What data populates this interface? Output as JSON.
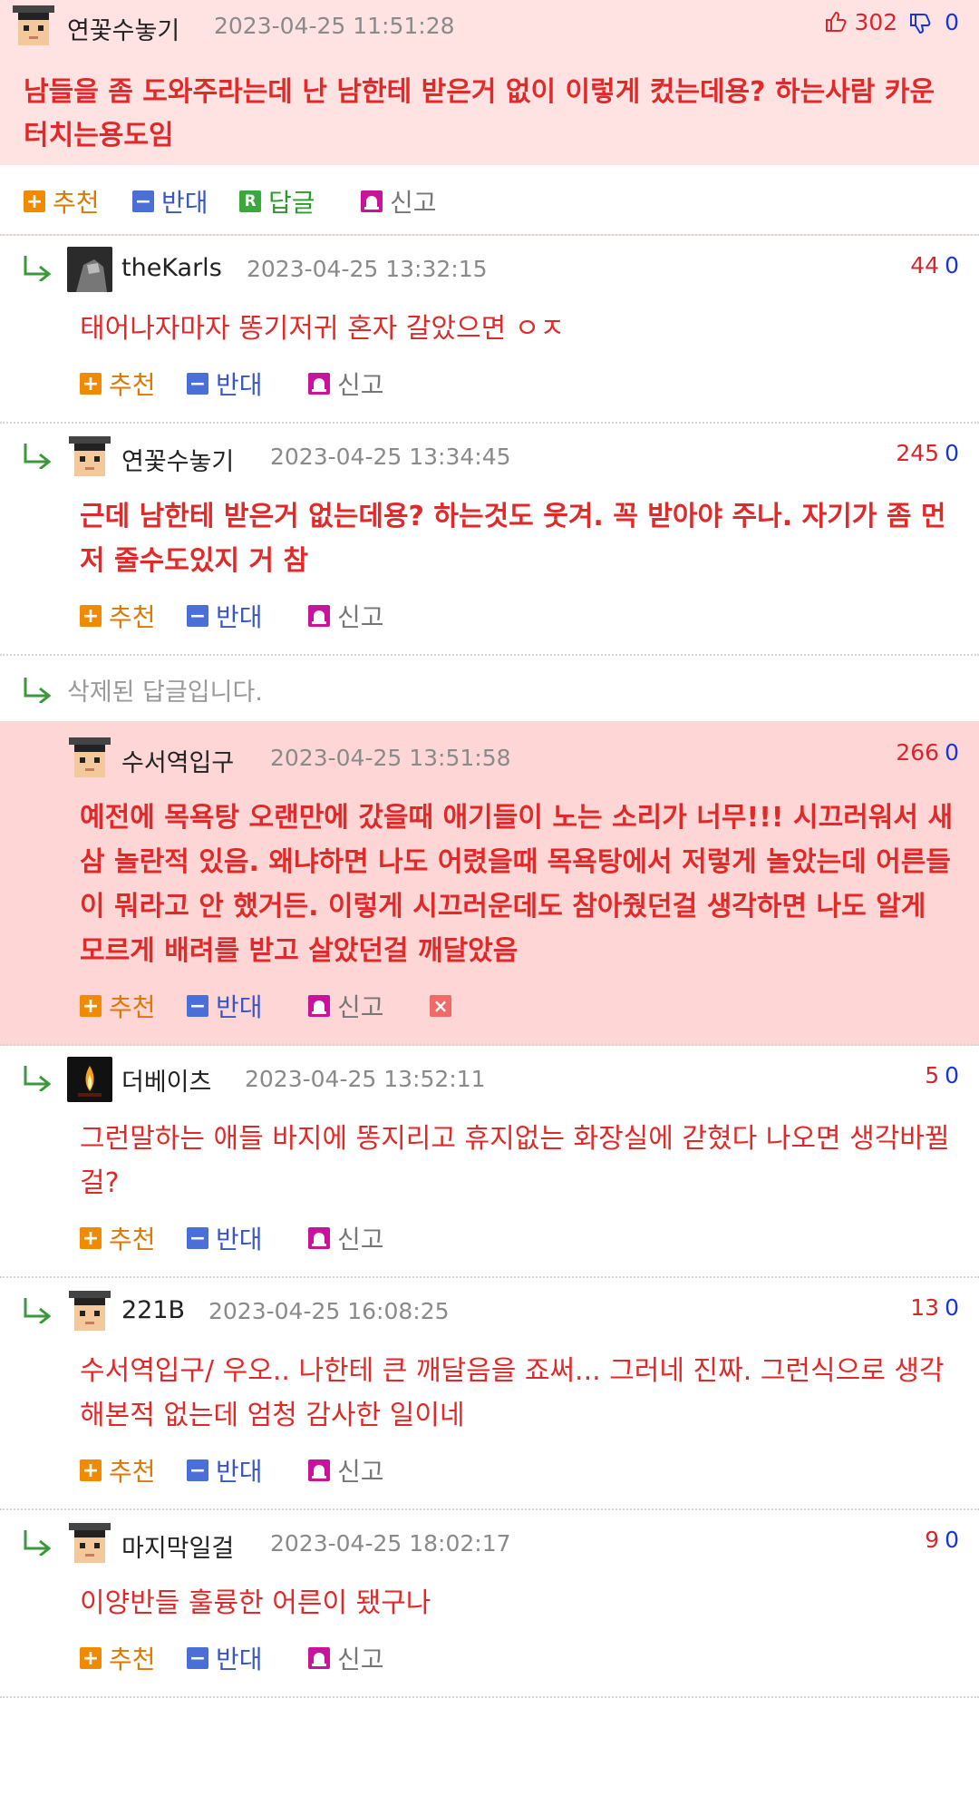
{
  "top_post": {
    "nick": "연꽃수놓기",
    "date": "2023-04-25 11:51:28",
    "up": "302",
    "down": "0",
    "text": "남들을 좀 도와주라는데 난 남한테 받은거 없이 이렇게 컸는데용? 하는사람 카운터치는용도임"
  },
  "labels": {
    "recommend": "추천",
    "oppose": "반대",
    "reply": "답글",
    "report": "신고",
    "reply_icon_letter": "R"
  },
  "comments": [
    {
      "nick": "theKarls",
      "date": "2023-04-25 13:32:15",
      "up": "44",
      "down": "0",
      "text": "태어나자마자 똥기저귀 혼자 갈았으면 ㅇㅈ"
    },
    {
      "nick": "연꽃수놓기",
      "date": "2023-04-25 13:34:45",
      "up": "245",
      "down": "0",
      "text": "근데 남한테 받은거 없는데용? 하는것도 웃겨. 꼭 받아야 주나. 자기가 좀 먼저 줄수도있지 거 참"
    },
    {
      "deleted_text": "삭제된 답글입니다."
    },
    {
      "nick": "수서역입구",
      "date": "2023-04-25 13:51:58",
      "up": "266",
      "down": "0",
      "text": "예전에 목욕탕 오랜만에 갔을때 애기들이 노는 소리가 너무!!! 시끄러워서 새삼 놀란적 있음. 왜냐하면 나도 어렸을때 목욕탕에서 저렇게 놀았는데 어른들이 뭐라고 안 했거든. 이렇게 시끄러운데도 참아줬던걸 생각하면 나도 알게 모르게 배려를 받고 살았던걸 깨달았음"
    },
    {
      "nick": "더베이츠",
      "date": "2023-04-25 13:52:11",
      "up": "5",
      "down": "0",
      "text": "그런말하는 애들 바지에 똥지리고 휴지없는 화장실에 갇혔다 나오면 생각바뀔걸?"
    },
    {
      "nick": "221B",
      "date": "2023-04-25 16:08:25",
      "up": "13",
      "down": "0",
      "text": "수서역입구/ 우오.. 나한테 큰 깨달음을 죠써... 그러네 진짜. 그런식으로 생각해본적 없는데 엄청 감사한 일이네"
    },
    {
      "nick": "마지막일걸",
      "date": "2023-04-25 18:02:17",
      "up": "9",
      "down": "0",
      "text": "이양반들 훌륭한 어른이 됐구나"
    }
  ],
  "icons": {
    "up": "thumbs-up-icon",
    "down": "thumbs-down-icon",
    "reply_arrow": "reply-arrow-icon",
    "report": "siren-icon",
    "delete": "close-icon"
  },
  "colors": {
    "comment_text": "#e02a2a",
    "recommend": "#e07800",
    "oppose": "#3a55c4",
    "reply": "#2e9a2e",
    "up_count": "#d9262d",
    "down_count": "#1a35d6",
    "highlight_bg": "#ffd6d6"
  }
}
